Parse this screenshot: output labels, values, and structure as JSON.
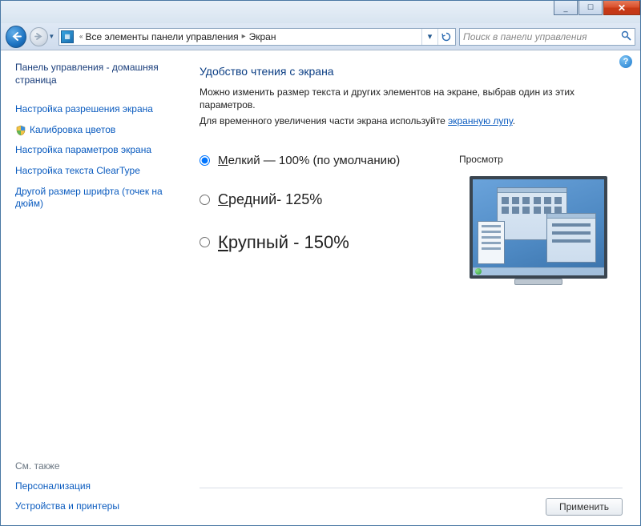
{
  "titlebar": {
    "min": "_",
    "max": "☐",
    "close": "✕"
  },
  "address": {
    "chevrons": "«",
    "parent": "Все элементы панели управления",
    "current": "Экран"
  },
  "search": {
    "placeholder": "Поиск в панели управления"
  },
  "sidebar": {
    "home": "Панель управления - домашняя страница",
    "links": [
      "Настройка разрешения экрана",
      "Калибровка цветов",
      "Настройка параметров экрана",
      "Настройка текста ClearType",
      "Другой размер шрифта (точек на дюйм)"
    ],
    "also_header": "См. также",
    "also": [
      "Персонализация",
      "Устройства и принтеры"
    ]
  },
  "main": {
    "heading": "Удобство чтения с экрана",
    "desc1": "Можно изменить размер текста и других элементов на экране, выбрав один из этих параметров.",
    "desc2_a": "Для временного увеличения части экрана используйте ",
    "desc2_link": "экранную лупу",
    "desc2_b": ".",
    "options": {
      "small_pre": "М",
      "small_rest": "елкий — 100% (по умолчанию)",
      "medium_pre": "С",
      "medium_rest": "редний- 125%",
      "large_pre": "К",
      "large_rest": "рупный - 150%"
    },
    "preview_label": "Просмотр",
    "apply": "Применить"
  }
}
